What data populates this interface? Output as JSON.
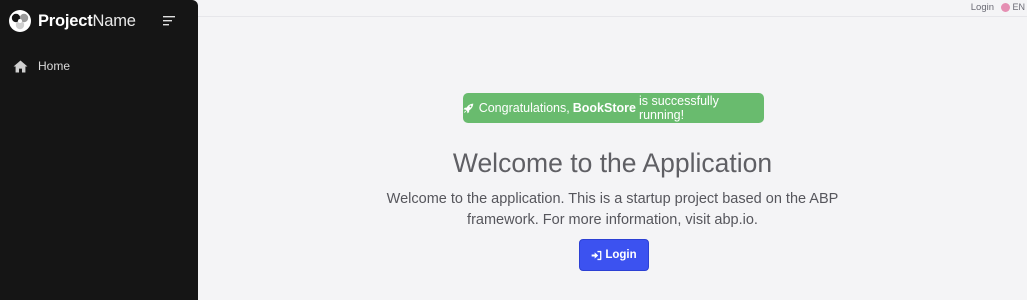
{
  "brand": {
    "name_bold": "Project",
    "name_light": "Name"
  },
  "sidebar": {
    "items": [
      {
        "label": "Home",
        "icon": "home-icon"
      }
    ]
  },
  "topbar": {
    "login_label": "Login",
    "language_label": "EN"
  },
  "banner": {
    "prefix": "Congratulations,",
    "app_name": "BookStore",
    "suffix": "is successfully running!",
    "color": "#69bb6e"
  },
  "welcome": {
    "title": "Welcome to the Application",
    "line1": "Welcome to the application. This is a startup project based on the ABP",
    "line2": "framework. For more information, visit abp.io."
  },
  "login_button": {
    "label": "Login",
    "color": "#3c52f0"
  }
}
